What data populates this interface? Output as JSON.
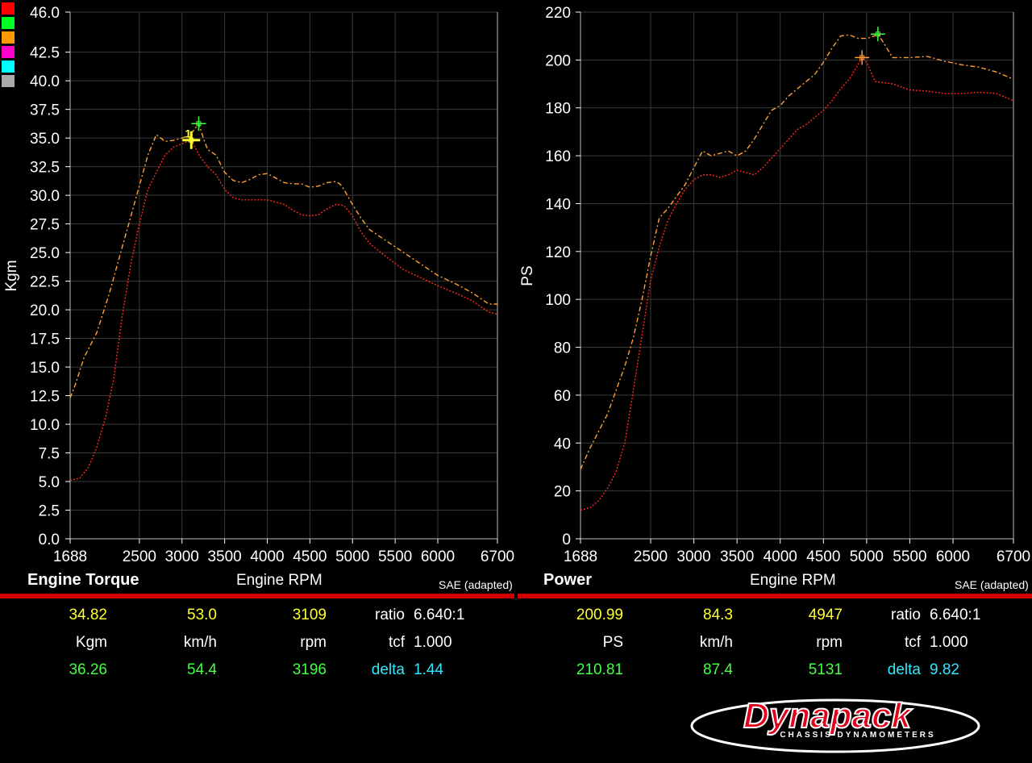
{
  "legend_colors": [
    "#ff0000",
    "#00ff22",
    "#ff9900",
    "#ff00cc",
    "#00ffff",
    "#aaaaaa"
  ],
  "colors": {
    "run_red": "#ff2a1a",
    "run_orange": "#ffa033",
    "marker_green": "#44ff44",
    "marker_yellow": "#ffff33",
    "grid": "#3a3a3a",
    "accent_bar": "#d20000"
  },
  "chart_data": [
    {
      "type": "line",
      "title": "Engine Torque",
      "xlabel": "Engine RPM",
      "ylabel": "Kgm",
      "correction": "SAE (adapted)",
      "xlim": [
        1688,
        6700
      ],
      "ylim": [
        0,
        46
      ],
      "x_ticks": [
        1688,
        2500,
        3000,
        3500,
        4000,
        4500,
        5000,
        5500,
        6000,
        6700
      ],
      "y_ticks": [
        0,
        2.5,
        5,
        7.5,
        10,
        12.5,
        15,
        17.5,
        20,
        22.5,
        25,
        27.5,
        30,
        32.5,
        35,
        37.5,
        40,
        42.5,
        46
      ],
      "y_tick_labels": [
        "0.0",
        "2.5",
        "5.0",
        "7.5",
        "10.0",
        "12.5",
        "15.0",
        "17.5",
        "20.0",
        "22.5",
        "25.0",
        "27.5",
        "30.0",
        "32.5",
        "35.0",
        "37.5",
        "40.0",
        "42.5",
        "46.0"
      ],
      "series": [
        {
          "color": "#ffa033",
          "x": [
            1688,
            1750,
            1850,
            2000,
            2150,
            2300,
            2450,
            2600,
            2700,
            2800,
            2900,
            3000,
            3100,
            3196,
            3250,
            3300,
            3400,
            3500,
            3600,
            3700,
            3800,
            3900,
            4000,
            4100,
            4200,
            4300,
            4400,
            4500,
            4600,
            4700,
            4800,
            4850,
            4900,
            5000,
            5100,
            5200,
            5400,
            5600,
            5800,
            6000,
            6200,
            6400,
            6600,
            6700
          ],
          "y": [
            12.3,
            13.5,
            15.8,
            18,
            21.5,
            25.5,
            29.5,
            33.5,
            35.3,
            34.7,
            34.8,
            35,
            35.3,
            36.26,
            35,
            34,
            33.5,
            32,
            31.3,
            31.1,
            31.4,
            31.8,
            31.9,
            31.5,
            31.1,
            31,
            31,
            30.7,
            30.8,
            31.1,
            31.2,
            31,
            30.5,
            29.2,
            28,
            27,
            26,
            25,
            24,
            23,
            22.3,
            21.5,
            20.5,
            20.5
          ]
        },
        {
          "color": "#ff2a1a",
          "x": [
            1688,
            1800,
            1900,
            2000,
            2100,
            2200,
            2300,
            2400,
            2500,
            2600,
            2700,
            2800,
            2900,
            3000,
            3109,
            3200,
            3300,
            3400,
            3500,
            3600,
            3700,
            3800,
            4000,
            4200,
            4300,
            4400,
            4500,
            4600,
            4700,
            4800,
            4900,
            5000,
            5100,
            5200,
            5400,
            5600,
            5800,
            6000,
            6200,
            6400,
            6600,
            6700
          ],
          "y": [
            5.1,
            5.3,
            6.2,
            8,
            10.5,
            14,
            19.5,
            24,
            27.5,
            30.5,
            32,
            33.5,
            34.2,
            34.5,
            34.82,
            33.5,
            32.5,
            31.8,
            30.5,
            29.8,
            29.6,
            29.6,
            29.6,
            29.2,
            28.7,
            28.3,
            28.2,
            28.3,
            28.8,
            29.2,
            29.1,
            28.2,
            26.8,
            25.8,
            24.6,
            23.5,
            22.8,
            22.1,
            21.5,
            20.8,
            19.8,
            19.6
          ]
        }
      ],
      "markers": [
        {
          "rpm": 3196,
          "value": 36.26,
          "color": "#44ff44"
        },
        {
          "rpm": 3109,
          "value": 34.82,
          "color": "#ffff33",
          "label": "1"
        }
      ]
    },
    {
      "type": "line",
      "title": "Power",
      "xlabel": "Engine RPM",
      "ylabel": "PS",
      "correction": "SAE (adapted)",
      "xlim": [
        1688,
        6700
      ],
      "ylim": [
        0,
        220
      ],
      "x_ticks": [
        1688,
        2500,
        3000,
        3500,
        4000,
        4500,
        5000,
        5500,
        6000,
        6700
      ],
      "y_ticks": [
        0,
        20,
        40,
        60,
        80,
        100,
        120,
        140,
        160,
        180,
        200,
        220
      ],
      "y_tick_labels": [
        "0",
        "20",
        "40",
        "60",
        "80",
        "100",
        "120",
        "140",
        "160",
        "180",
        "200",
        "220"
      ],
      "series": [
        {
          "color": "#ffa033",
          "x": [
            1688,
            1800,
            1900,
            2000,
            2100,
            2200,
            2300,
            2400,
            2500,
            2600,
            2700,
            2800,
            2900,
            3000,
            3100,
            3200,
            3300,
            3400,
            3500,
            3600,
            3700,
            3800,
            3900,
            4000,
            4100,
            4200,
            4300,
            4400,
            4500,
            4600,
            4700,
            4800,
            4900,
            5000,
            5050,
            5131,
            5200,
            5300,
            5500,
            5700,
            5900,
            6100,
            6300,
            6500,
            6700
          ],
          "y": [
            29,
            38,
            45,
            52,
            62,
            72,
            84,
            100,
            118,
            134,
            138,
            143,
            148,
            155,
            162,
            160,
            161,
            162,
            160,
            162,
            167,
            173,
            179,
            181,
            185,
            188,
            191,
            194,
            199,
            205,
            210,
            210.5,
            209,
            209,
            209.5,
            210.81,
            207,
            201,
            201,
            201.5,
            199.5,
            198,
            197,
            195,
            192
          ]
        },
        {
          "color": "#ff2a1a",
          "x": [
            1688,
            1800,
            1900,
            2000,
            2100,
            2200,
            2300,
            2400,
            2500,
            2600,
            2700,
            2800,
            2900,
            3000,
            3100,
            3200,
            3300,
            3400,
            3500,
            3600,
            3700,
            3800,
            3900,
            4000,
            4100,
            4200,
            4300,
            4400,
            4500,
            4600,
            4700,
            4800,
            4900,
            4947,
            5000,
            5100,
            5300,
            5500,
            5700,
            5900,
            6100,
            6300,
            6500,
            6700
          ],
          "y": [
            12,
            13,
            16,
            21,
            28,
            40,
            62,
            85,
            108,
            122,
            133,
            140,
            146,
            150,
            152,
            152,
            151,
            152,
            154,
            153,
            152,
            155,
            159,
            163,
            167,
            171,
            173,
            176,
            179,
            183,
            188,
            192,
            198,
            200.99,
            199,
            191,
            190,
            187.5,
            187,
            186,
            186,
            186.5,
            186,
            183
          ]
        }
      ],
      "markers": [
        {
          "rpm": 5131,
          "value": 210.81,
          "color": "#44ff44"
        },
        {
          "rpm": 4947,
          "value": 200.99,
          "color": "#ffa033"
        }
      ]
    }
  ],
  "torque_stats": {
    "run1": {
      "value": "34.82",
      "speed": "53.0",
      "rpm": "3109"
    },
    "units": {
      "value": "Kgm",
      "speed": "km/h",
      "rpm": "rpm"
    },
    "run2": {
      "value": "36.26",
      "speed": "54.4",
      "rpm": "3196"
    },
    "ratio_label": "ratio",
    "ratio": "6.640:1",
    "tcf_label": "tcf",
    "tcf": "1.000",
    "delta_label": "delta",
    "delta": "1.44"
  },
  "power_stats": {
    "run1": {
      "value": "200.99",
      "speed": "84.3",
      "rpm": "4947"
    },
    "units": {
      "value": "PS",
      "speed": "km/h",
      "rpm": "rpm"
    },
    "run2": {
      "value": "210.81",
      "speed": "87.4",
      "rpm": "5131"
    },
    "ratio_label": "ratio",
    "ratio": "6.640:1",
    "tcf_label": "tcf",
    "tcf": "1.000",
    "delta_label": "delta",
    "delta": "9.82"
  },
  "logo": {
    "brand": "Dynapack",
    "tagline": "CHASSIS DYNAMOMETERS"
  }
}
